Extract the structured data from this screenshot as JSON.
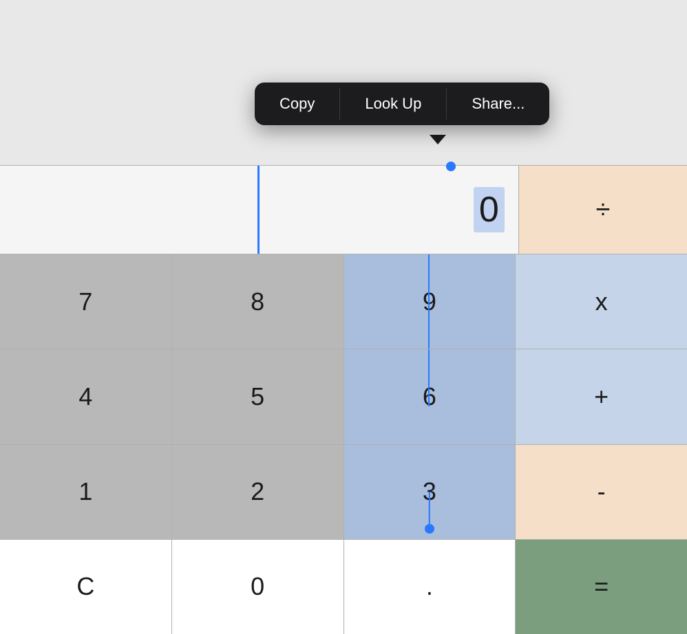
{
  "contextMenu": {
    "items": [
      {
        "id": "copy",
        "label": "Copy"
      },
      {
        "id": "lookup",
        "label": "Look Up"
      },
      {
        "id": "share",
        "label": "Share..."
      }
    ]
  },
  "display": {
    "value": "0",
    "operator": "÷"
  },
  "rows": [
    {
      "keys": [
        {
          "id": "7",
          "label": "7",
          "type": "gray"
        },
        {
          "id": "8",
          "label": "8",
          "type": "gray"
        },
        {
          "id": "9",
          "label": "9",
          "type": "selected-col"
        },
        {
          "id": "multiply",
          "label": "x",
          "type": "blue-light"
        }
      ]
    },
    {
      "keys": [
        {
          "id": "4",
          "label": "4",
          "type": "gray"
        },
        {
          "id": "5",
          "label": "5",
          "type": "gray"
        },
        {
          "id": "6",
          "label": "6",
          "type": "selected-col"
        },
        {
          "id": "add",
          "label": "+",
          "type": "blue-light"
        }
      ]
    },
    {
      "keys": [
        {
          "id": "1",
          "label": "1",
          "type": "gray"
        },
        {
          "id": "2",
          "label": "2",
          "type": "gray"
        },
        {
          "id": "3",
          "label": "3",
          "type": "selected-col"
        },
        {
          "id": "subtract",
          "label": "-",
          "type": "orange-light"
        }
      ]
    },
    {
      "keys": [
        {
          "id": "clear",
          "label": "C",
          "type": "white"
        },
        {
          "id": "0",
          "label": "0",
          "type": "white"
        },
        {
          "id": "decimal",
          "label": ".",
          "type": "white"
        },
        {
          "id": "equals",
          "label": "=",
          "type": "green"
        }
      ]
    }
  ]
}
